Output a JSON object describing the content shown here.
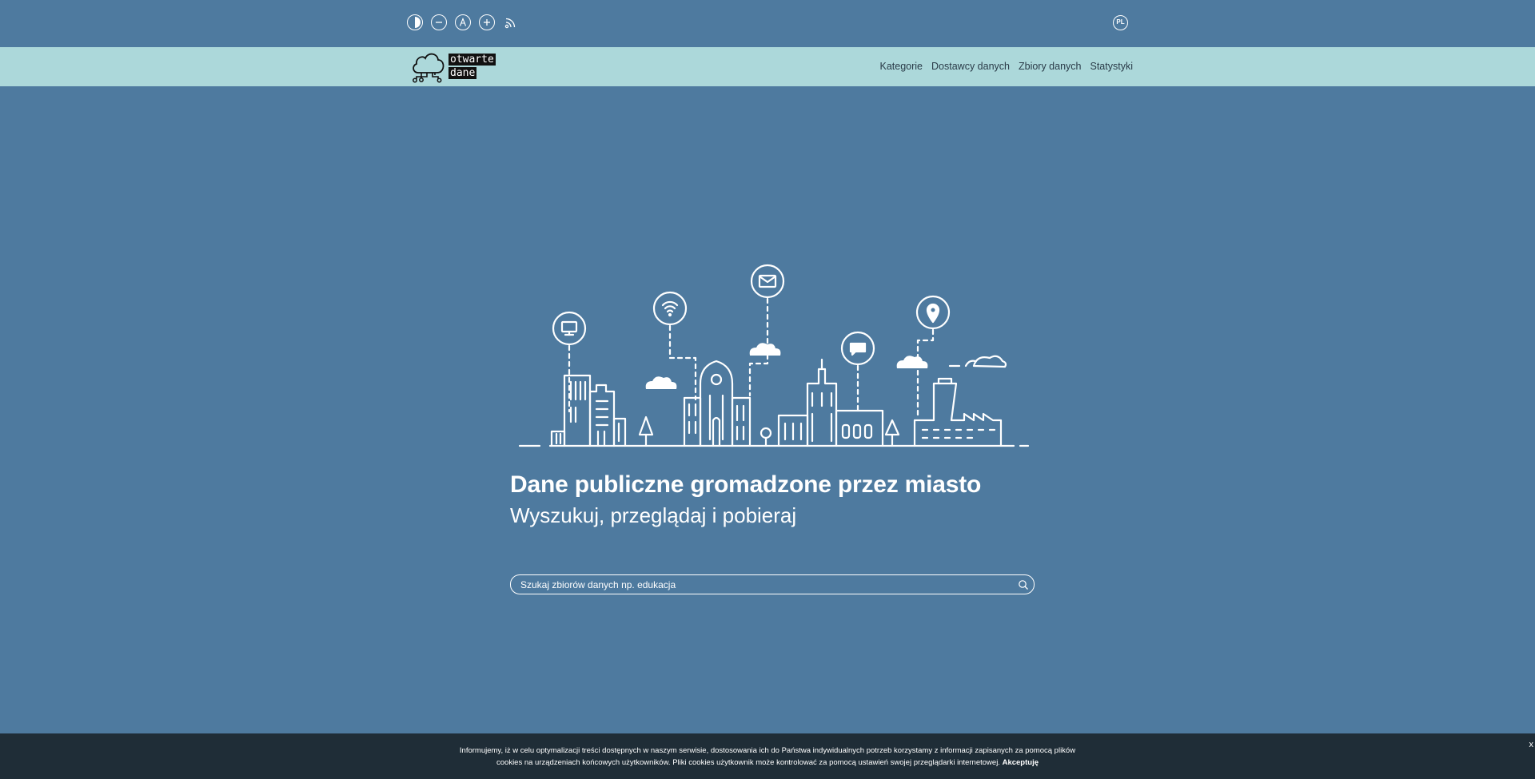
{
  "a11y": {
    "icons": [
      "contrast-icon",
      "zoom-out-icon",
      "font-icon",
      "zoom-in-icon",
      "rss-icon"
    ],
    "lang": "PL"
  },
  "logo": {
    "line1": "otwarte",
    "line2": "dane"
  },
  "nav": {
    "items": [
      "Kategorie",
      "Dostawcy danych",
      "Zbiory danych",
      "Statystyki"
    ]
  },
  "hero": {
    "title": "Dane publiczne gromadzone przez miasto",
    "subtitle": "Wyszukuj, przeglądaj i pobieraj"
  },
  "search": {
    "placeholder": "Szukaj zbiorów danych np. edukacja"
  },
  "cookie": {
    "text": "Informujemy, iż w celu optymalizacji treści dostępnych w naszym serwisie, dostosowania ich do Państwa indywidualnych potrzeb korzystamy z informacji zapisanych za pomocą plików cookies na urządzeniach końcowych użytkowników. Pliki cookies użytkownik może kontrolować za pomocą ustawień swojej przeglądarki internetowej.",
    "accept": "Akceptuję",
    "close": "x"
  },
  "colors": {
    "background": "#4e7a9f",
    "header": "#acd8da",
    "cookie_bar": "#1f2d37",
    "nav_text": "#2a3b48"
  }
}
